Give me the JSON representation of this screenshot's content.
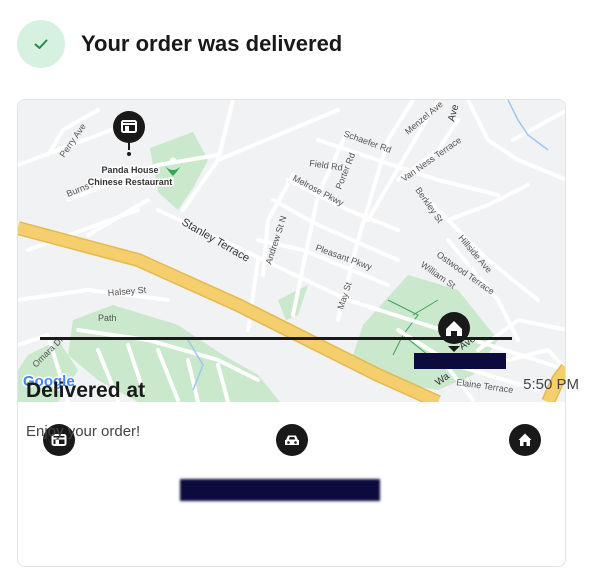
{
  "header": {
    "title": "Your order was delivered",
    "icon": "check-icon"
  },
  "map": {
    "restaurant_line1": "Panda House",
    "restaurant_line2": "Chinese Restaurant",
    "streets": {
      "stanley": "Stanley Terrace",
      "perry": "Perry Ave",
      "burns": "Burns Ave",
      "field": "Field Rd",
      "melrose": "Melrose Pkwy",
      "porter": "Porter Rd",
      "schaefer": "Schaefer Rd",
      "menzel": "Menzel Ave",
      "van_ness": "Van Ness Terrace",
      "berkley": "Berkley St",
      "andrew": "Andrew St N",
      "pleasant": "Pleasant Pkwy",
      "may": "May St",
      "hillside": "Hillside Ave",
      "ostwood": "Ostwood Terrace",
      "william": "William St",
      "halsey": "Halsey St",
      "path": "Path",
      "omara": "Omara Dr",
      "elaine": "Elaine Terrace",
      "ave": "Ave",
      "wa": "Wa",
      "ave2": "Ave"
    },
    "logo": "Google"
  },
  "progress": {
    "steps": [
      "store-icon",
      "car-icon",
      "home-icon"
    ]
  },
  "delivery": {
    "label": "Delivered at",
    "time": "5:50 PM",
    "message": "Enjoy your order!"
  },
  "colors": {
    "check_bg": "#d6f1df",
    "check": "#1f8a4c",
    "highway": "#f5cf6e",
    "park": "#c9e8cc",
    "map_bg": "#f1f2f4",
    "redaction": "#0d0a3e"
  }
}
